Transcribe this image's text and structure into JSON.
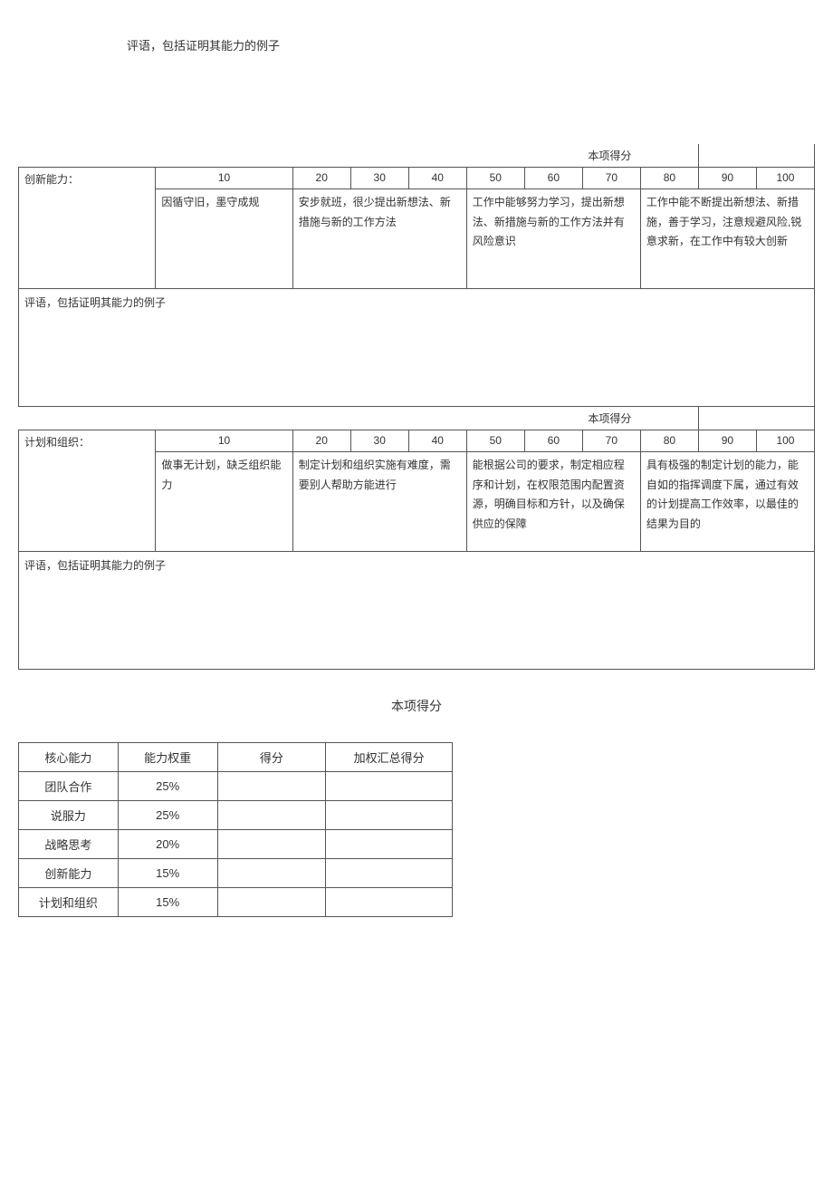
{
  "topText": "评语，包括证明其能力的例子",
  "scoreLabel": "本项得分",
  "scores": {
    "s10": "10",
    "s20": "20",
    "s30": "30",
    "s40": "40",
    "s50": "50",
    "s60": "60",
    "s70": "70",
    "s80": "80",
    "s90": "90",
    "s100": "100"
  },
  "rubric1": {
    "label": "创新能力：",
    "d1": "因循守旧，墨守成规",
    "d2": "安步就班，很少提出新想法、新措施与新的工作方法",
    "d3": "工作中能够努力学习，提出新想法、新措施与新的工作方法并有风险意识",
    "d4": "工作中能不断提出新想法、新措施，善于学习，注意规避风险,锐意求新，在工作中有较大创新",
    "comment": "评语，包括证明其能力的例子"
  },
  "rubric2": {
    "label": "计划和组织：",
    "d1": "做事无计划，缺乏组织能力",
    "d2": "制定计划和组织实施有难度，需要别人帮助方能进行",
    "d3": "能根据公司的要求，制定相应程序和计划，在权限范围内配置资源，明确目标和方针，以及确保供应的保障",
    "d4": "具有极强的制定计划的能力，能自如的指挥调度下属，通过有效的计划提高工作效率，以最佳的结果为目的",
    "comment": "评语，包括证明其能力的例子"
  },
  "bottomScoreText": "本项得分",
  "summary": {
    "h1": "核心能力",
    "h2": "能力权重",
    "h3": "得分",
    "h4": "加权汇总得分",
    "r1c1": "团队合作",
    "r1c2": "25%",
    "r2c1": "说服力",
    "r2c2": "25%",
    "r3c1": "战略思考",
    "r3c2": "20%",
    "r4c1": "创新能力",
    "r4c2": "15%",
    "r5c1": "计划和组织",
    "r5c2": "15%"
  }
}
